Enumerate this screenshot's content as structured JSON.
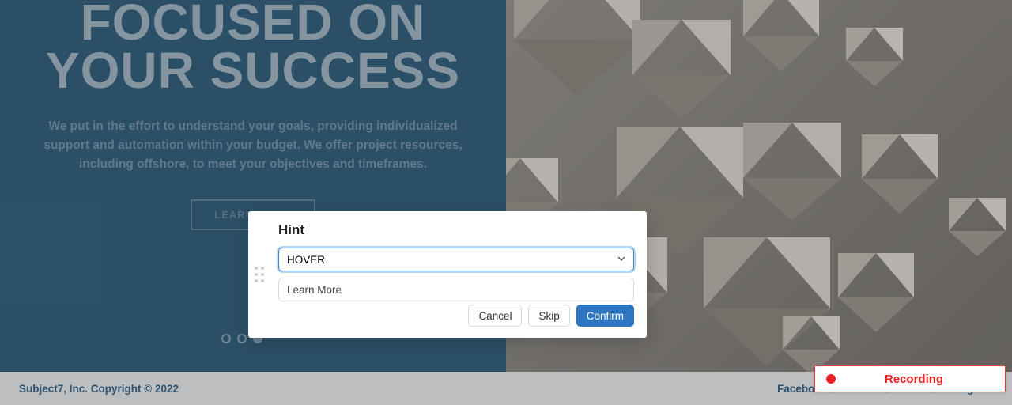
{
  "hero": {
    "title_line1": "FOCUSED ON",
    "title_line2": "YOUR SUCCESS",
    "subtext": "We put in the effort to understand your goals, providing individualized support and automation within your budget. We offer project resources, including offshore, to meet your objectives and timeframes.",
    "learn_more_label": "LEARN MORE"
  },
  "carousel": {
    "active_index": 2,
    "count": 3
  },
  "footer": {
    "copyright": "Subject7, Inc. Copyright © 2022",
    "social": [
      "Facebook",
      "LinkedIn",
      "Twitter",
      "Instagram"
    ]
  },
  "dialog": {
    "title": "Hint",
    "select_value": "HOVER",
    "text_value": "Learn More",
    "cancel_label": "Cancel",
    "skip_label": "Skip",
    "confirm_label": "Confirm"
  },
  "recorder": {
    "label": "Recording"
  }
}
